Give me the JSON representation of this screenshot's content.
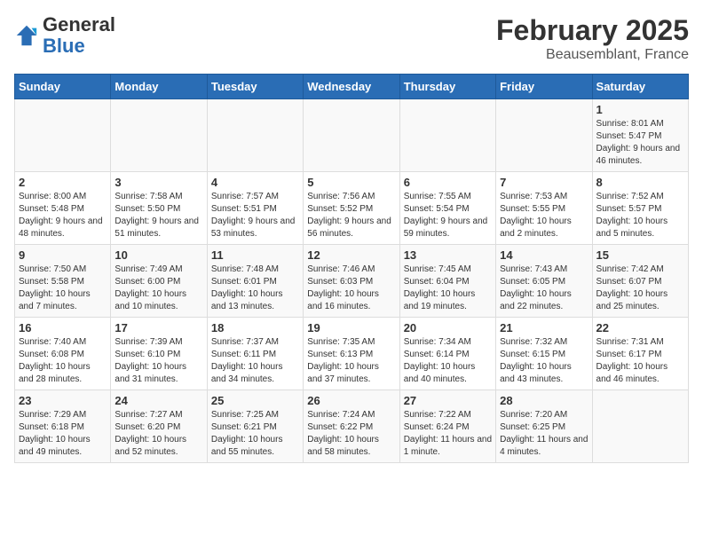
{
  "logo": {
    "general": "General",
    "blue": "Blue"
  },
  "title": "February 2025",
  "subtitle": "Beausemblant, France",
  "days_of_week": [
    "Sunday",
    "Monday",
    "Tuesday",
    "Wednesday",
    "Thursday",
    "Friday",
    "Saturday"
  ],
  "weeks": [
    [
      {
        "day": "",
        "info": ""
      },
      {
        "day": "",
        "info": ""
      },
      {
        "day": "",
        "info": ""
      },
      {
        "day": "",
        "info": ""
      },
      {
        "day": "",
        "info": ""
      },
      {
        "day": "",
        "info": ""
      },
      {
        "day": "1",
        "info": "Sunrise: 8:01 AM\nSunset: 5:47 PM\nDaylight: 9 hours and 46 minutes."
      }
    ],
    [
      {
        "day": "2",
        "info": "Sunrise: 8:00 AM\nSunset: 5:48 PM\nDaylight: 9 hours and 48 minutes."
      },
      {
        "day": "3",
        "info": "Sunrise: 7:58 AM\nSunset: 5:50 PM\nDaylight: 9 hours and 51 minutes."
      },
      {
        "day": "4",
        "info": "Sunrise: 7:57 AM\nSunset: 5:51 PM\nDaylight: 9 hours and 53 minutes."
      },
      {
        "day": "5",
        "info": "Sunrise: 7:56 AM\nSunset: 5:52 PM\nDaylight: 9 hours and 56 minutes."
      },
      {
        "day": "6",
        "info": "Sunrise: 7:55 AM\nSunset: 5:54 PM\nDaylight: 9 hours and 59 minutes."
      },
      {
        "day": "7",
        "info": "Sunrise: 7:53 AM\nSunset: 5:55 PM\nDaylight: 10 hours and 2 minutes."
      },
      {
        "day": "8",
        "info": "Sunrise: 7:52 AM\nSunset: 5:57 PM\nDaylight: 10 hours and 5 minutes."
      }
    ],
    [
      {
        "day": "9",
        "info": "Sunrise: 7:50 AM\nSunset: 5:58 PM\nDaylight: 10 hours and 7 minutes."
      },
      {
        "day": "10",
        "info": "Sunrise: 7:49 AM\nSunset: 6:00 PM\nDaylight: 10 hours and 10 minutes."
      },
      {
        "day": "11",
        "info": "Sunrise: 7:48 AM\nSunset: 6:01 PM\nDaylight: 10 hours and 13 minutes."
      },
      {
        "day": "12",
        "info": "Sunrise: 7:46 AM\nSunset: 6:03 PM\nDaylight: 10 hours and 16 minutes."
      },
      {
        "day": "13",
        "info": "Sunrise: 7:45 AM\nSunset: 6:04 PM\nDaylight: 10 hours and 19 minutes."
      },
      {
        "day": "14",
        "info": "Sunrise: 7:43 AM\nSunset: 6:05 PM\nDaylight: 10 hours and 22 minutes."
      },
      {
        "day": "15",
        "info": "Sunrise: 7:42 AM\nSunset: 6:07 PM\nDaylight: 10 hours and 25 minutes."
      }
    ],
    [
      {
        "day": "16",
        "info": "Sunrise: 7:40 AM\nSunset: 6:08 PM\nDaylight: 10 hours and 28 minutes."
      },
      {
        "day": "17",
        "info": "Sunrise: 7:39 AM\nSunset: 6:10 PM\nDaylight: 10 hours and 31 minutes."
      },
      {
        "day": "18",
        "info": "Sunrise: 7:37 AM\nSunset: 6:11 PM\nDaylight: 10 hours and 34 minutes."
      },
      {
        "day": "19",
        "info": "Sunrise: 7:35 AM\nSunset: 6:13 PM\nDaylight: 10 hours and 37 minutes."
      },
      {
        "day": "20",
        "info": "Sunrise: 7:34 AM\nSunset: 6:14 PM\nDaylight: 10 hours and 40 minutes."
      },
      {
        "day": "21",
        "info": "Sunrise: 7:32 AM\nSunset: 6:15 PM\nDaylight: 10 hours and 43 minutes."
      },
      {
        "day": "22",
        "info": "Sunrise: 7:31 AM\nSunset: 6:17 PM\nDaylight: 10 hours and 46 minutes."
      }
    ],
    [
      {
        "day": "23",
        "info": "Sunrise: 7:29 AM\nSunset: 6:18 PM\nDaylight: 10 hours and 49 minutes."
      },
      {
        "day": "24",
        "info": "Sunrise: 7:27 AM\nSunset: 6:20 PM\nDaylight: 10 hours and 52 minutes."
      },
      {
        "day": "25",
        "info": "Sunrise: 7:25 AM\nSunset: 6:21 PM\nDaylight: 10 hours and 55 minutes."
      },
      {
        "day": "26",
        "info": "Sunrise: 7:24 AM\nSunset: 6:22 PM\nDaylight: 10 hours and 58 minutes."
      },
      {
        "day": "27",
        "info": "Sunrise: 7:22 AM\nSunset: 6:24 PM\nDaylight: 11 hours and 1 minute."
      },
      {
        "day": "28",
        "info": "Sunrise: 7:20 AM\nSunset: 6:25 PM\nDaylight: 11 hours and 4 minutes."
      },
      {
        "day": "",
        "info": ""
      }
    ]
  ]
}
